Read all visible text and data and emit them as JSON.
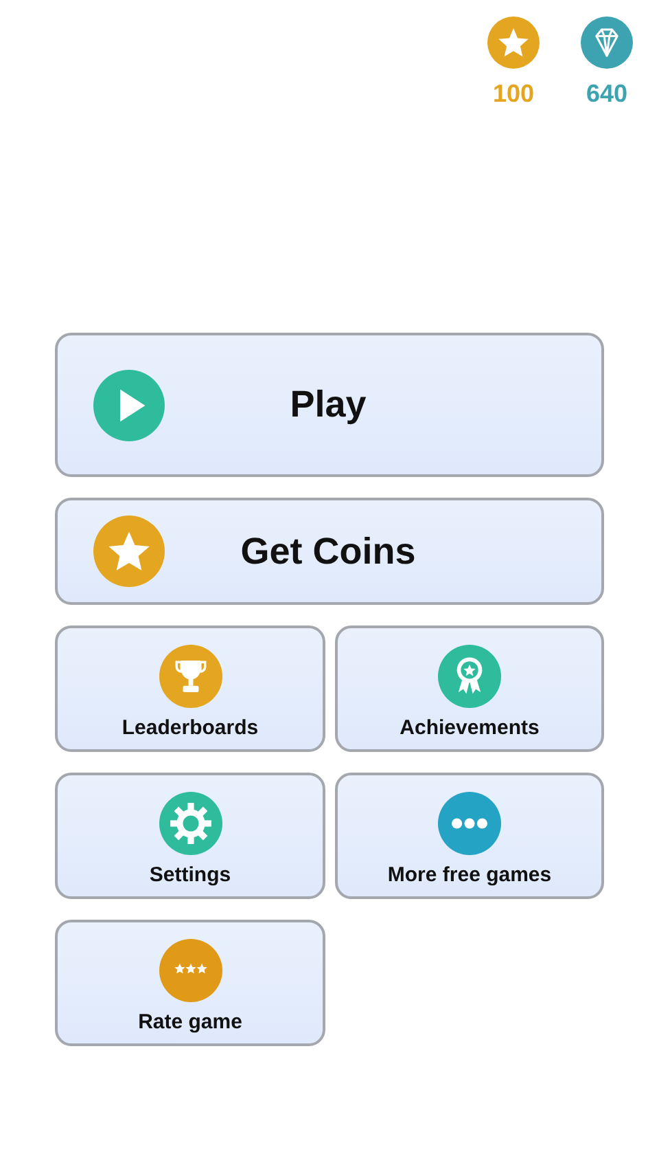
{
  "currencies": [
    {
      "kind": "coin",
      "amount": "100"
    },
    {
      "kind": "gem",
      "amount": "640"
    }
  ],
  "main_buttons": [
    {
      "kind": "play",
      "label": "Play"
    },
    {
      "kind": "coins",
      "label": "Get Coins"
    }
  ],
  "tiles": [
    {
      "kind": "trophy",
      "label": "Leaderboards"
    },
    {
      "kind": "medal",
      "label": "Achievements"
    },
    {
      "kind": "gear",
      "label": "Settings"
    },
    {
      "kind": "dots",
      "label": "More free games"
    },
    {
      "kind": "rate",
      "label": "Rate game"
    }
  ]
}
